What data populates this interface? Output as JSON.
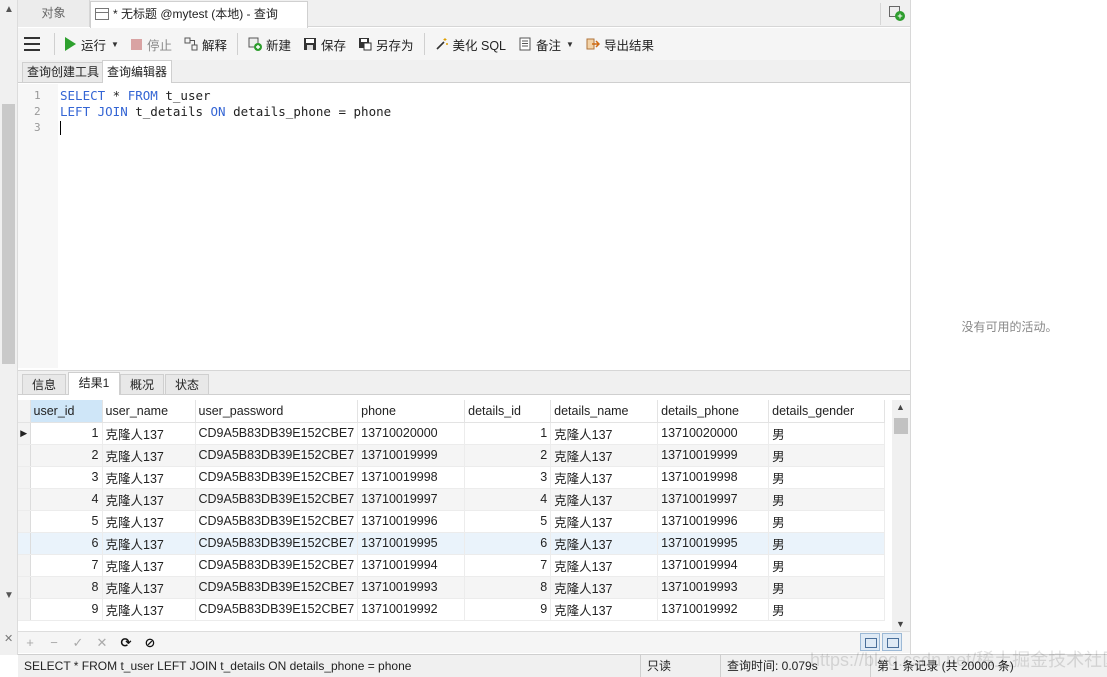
{
  "tabs": {
    "objects_label": "对象",
    "query_tab_title": "* 无标题 @mytest (本地) - 查询"
  },
  "toolbar": {
    "run": "运行",
    "stop": "停止",
    "explain": "解释",
    "new": "新建",
    "save": "保存",
    "save_as": "另存为",
    "beautify": "美化 SQL",
    "comment": "备注",
    "export": "导出结果"
  },
  "subtabs": {
    "builder": "查询创建工具",
    "editor": "查询编辑器"
  },
  "editor": {
    "line_numbers": [
      "1",
      "2",
      "3"
    ],
    "line1": {
      "kw1": "SELECT",
      "mid": " * ",
      "kw2": "FROM",
      "rest": " t_user"
    },
    "line2": {
      "kw1": "LEFT JOIN",
      "mid": " t_details ",
      "kw2": "ON",
      "rest": " details_phone = phone"
    }
  },
  "right_panel": {
    "message": "没有可用的活动。"
  },
  "result_tabs": [
    "信息",
    "结果1",
    "概况",
    "状态"
  ],
  "grid": {
    "columns": [
      "user_id",
      "user_name",
      "user_password",
      "phone",
      "details_id",
      "details_name",
      "details_phone",
      "details_gender"
    ],
    "rows": [
      [
        "1",
        "克隆人137",
        "CD9A5B83DB39E152CBE7",
        "13710020000",
        "1",
        "克隆人137",
        "13710020000",
        "男"
      ],
      [
        "2",
        "克隆人137",
        "CD9A5B83DB39E152CBE7",
        "13710019999",
        "2",
        "克隆人137",
        "13710019999",
        "男"
      ],
      [
        "3",
        "克隆人137",
        "CD9A5B83DB39E152CBE7",
        "13710019998",
        "3",
        "克隆人137",
        "13710019998",
        "男"
      ],
      [
        "4",
        "克隆人137",
        "CD9A5B83DB39E152CBE7",
        "13710019997",
        "4",
        "克隆人137",
        "13710019997",
        "男"
      ],
      [
        "5",
        "克隆人137",
        "CD9A5B83DB39E152CBE7",
        "13710019996",
        "5",
        "克隆人137",
        "13710019996",
        "男"
      ],
      [
        "6",
        "克隆人137",
        "CD9A5B83DB39E152CBE7",
        "13710019995",
        "6",
        "克隆人137",
        "13710019995",
        "男"
      ],
      [
        "7",
        "克隆人137",
        "CD9A5B83DB39E152CBE7",
        "13710019994",
        "7",
        "克隆人137",
        "13710019994",
        "男"
      ],
      [
        "8",
        "克隆人137",
        "CD9A5B83DB39E152CBE7",
        "13710019993",
        "8",
        "克隆人137",
        "13710019993",
        "男"
      ],
      [
        "9",
        "克隆人137",
        "CD9A5B83DB39E152CBE7",
        "13710019992",
        "9",
        "克隆人137",
        "13710019992",
        "男"
      ]
    ]
  },
  "navbar": {
    "add": "+",
    "remove": "−",
    "apply": "✓",
    "discard": "✕",
    "refresh": "⟳",
    "stop": "⊘"
  },
  "status": {
    "sql": "SELECT * FROM t_user LEFT JOIN t_details ON details_phone = phone",
    "readonly": "只读",
    "query_time": "查询时间: 0.079s",
    "record": "第 1 条记录 (共 20000 条)"
  },
  "watermark": "https://blog.csdn.net/稀土掘金技术社区"
}
